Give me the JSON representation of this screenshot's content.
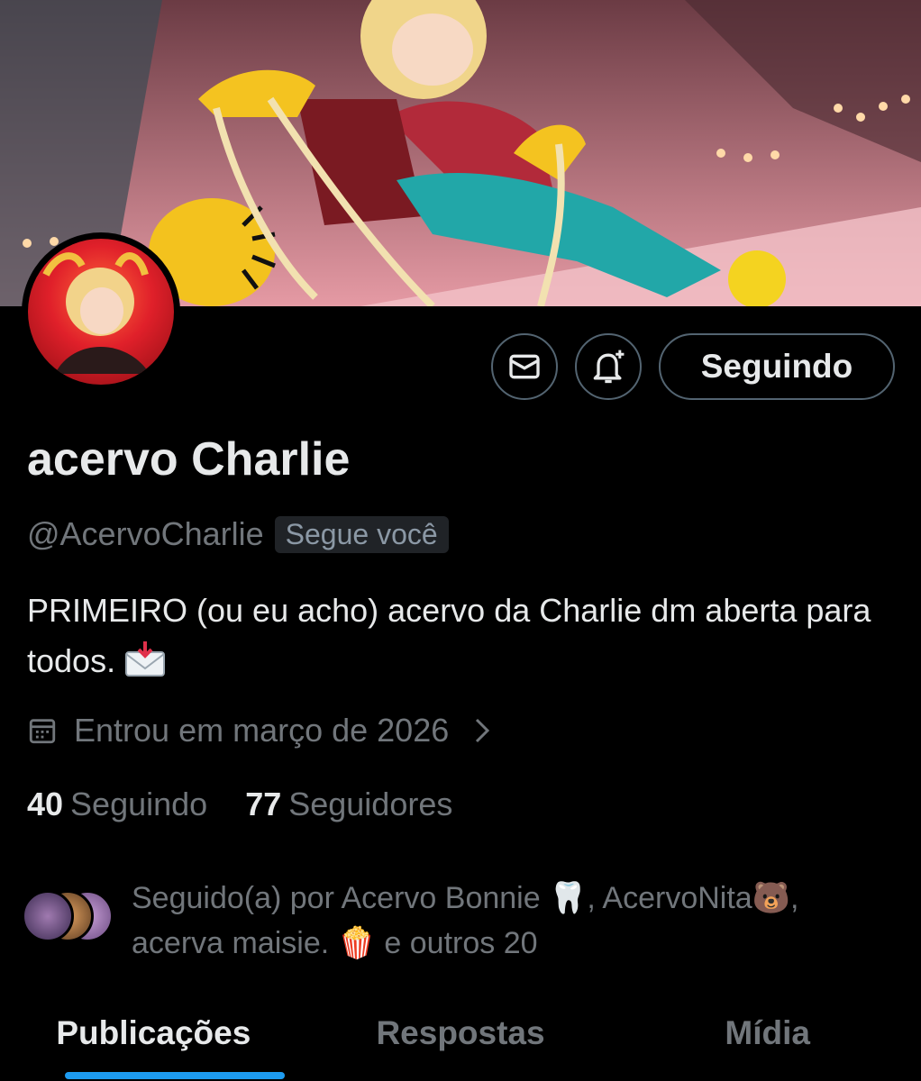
{
  "profile": {
    "display_name": "acervo Charlie",
    "handle": "@AcervoCharlie",
    "follows_you_badge": "Segue você",
    "bio_text": "PRIMEIRO (ou eu acho) acervo da Charlie dm aberta para todos.",
    "joined_text": "Entrou em março de 2026"
  },
  "actions": {
    "message_icon": "envelope-icon",
    "notify_icon": "bell-plus-icon",
    "follow_label": "Seguindo"
  },
  "stats": {
    "following_count": "40",
    "following_label": "Seguindo",
    "followers_count": "77",
    "followers_label": "Seguidores"
  },
  "followed_by": {
    "prefix": "Seguido(a) por ",
    "names_line1": "Acervo Bonnie 🦷, AcervoNita🐻,",
    "names_line2": "acerva maisie. 🍿 e outros 20"
  },
  "tabs": [
    {
      "label": "Publicações",
      "active": true
    },
    {
      "label": "Respostas",
      "active": false
    },
    {
      "label": "Mídia",
      "active": false
    }
  ],
  "colors": {
    "accent": "#1d9bf0",
    "background": "#000000",
    "text_primary": "#e7e9ea",
    "text_secondary": "#71767b",
    "border": "#536471"
  }
}
